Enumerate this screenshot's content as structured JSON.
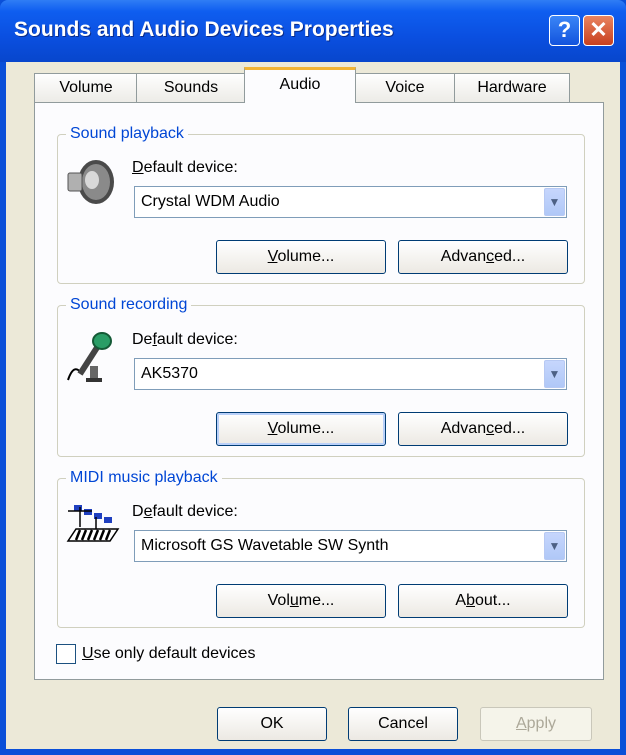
{
  "window": {
    "title": "Sounds and Audio Devices Properties",
    "help_button": "?",
    "close_button": "✕"
  },
  "tabs": [
    {
      "label": "Volume"
    },
    {
      "label": "Sounds"
    },
    {
      "label": "Audio",
      "selected": true
    },
    {
      "label": "Voice"
    },
    {
      "label": "Hardware"
    }
  ],
  "sound_playback": {
    "group_title": "Sound playback",
    "icon": "speaker-icon",
    "default_label_mnemonic": "D",
    "default_label_rest": "efault device:",
    "device_value": "Crystal WDM Audio",
    "volume_mnemonic": "V",
    "volume_rest": "olume...",
    "advanced_pre": "Advan",
    "advanced_mnemonic": "c",
    "advanced_post": "ed..."
  },
  "sound_recording": {
    "group_title": "Sound recording",
    "icon": "microphone-icon",
    "default_pre": "De",
    "default_mnemonic": "f",
    "default_post": "ault device:",
    "device_value": "AK5370",
    "volume_mnemonic": "V",
    "volume_rest": "olume...",
    "advanced_pre": "Advan",
    "advanced_mnemonic": "c",
    "advanced_post": "ed..."
  },
  "midi_playback": {
    "group_title": "MIDI music playback",
    "icon": "midi-keyboard-icon",
    "default_pre": "D",
    "default_mnemonic": "e",
    "default_post": "fault device:",
    "device_value": "Microsoft GS Wavetable SW Synth",
    "volume_pre": "Vol",
    "volume_mnemonic": "u",
    "volume_post": "me...",
    "about_pre": "A",
    "about_mnemonic": "b",
    "about_post": "out..."
  },
  "use_only_default": {
    "mnemonic": "U",
    "rest": "se only default devices",
    "checked": false
  },
  "footer": {
    "ok_label": "OK",
    "cancel_label": "Cancel",
    "apply_mnemonic": "A",
    "apply_rest": "pply"
  },
  "colors": {
    "title_bar": "#0a4fe0",
    "group_title": "#0046d5",
    "active_tab_accent": "#f1b436",
    "dialog_bg": "#ece9d8"
  }
}
